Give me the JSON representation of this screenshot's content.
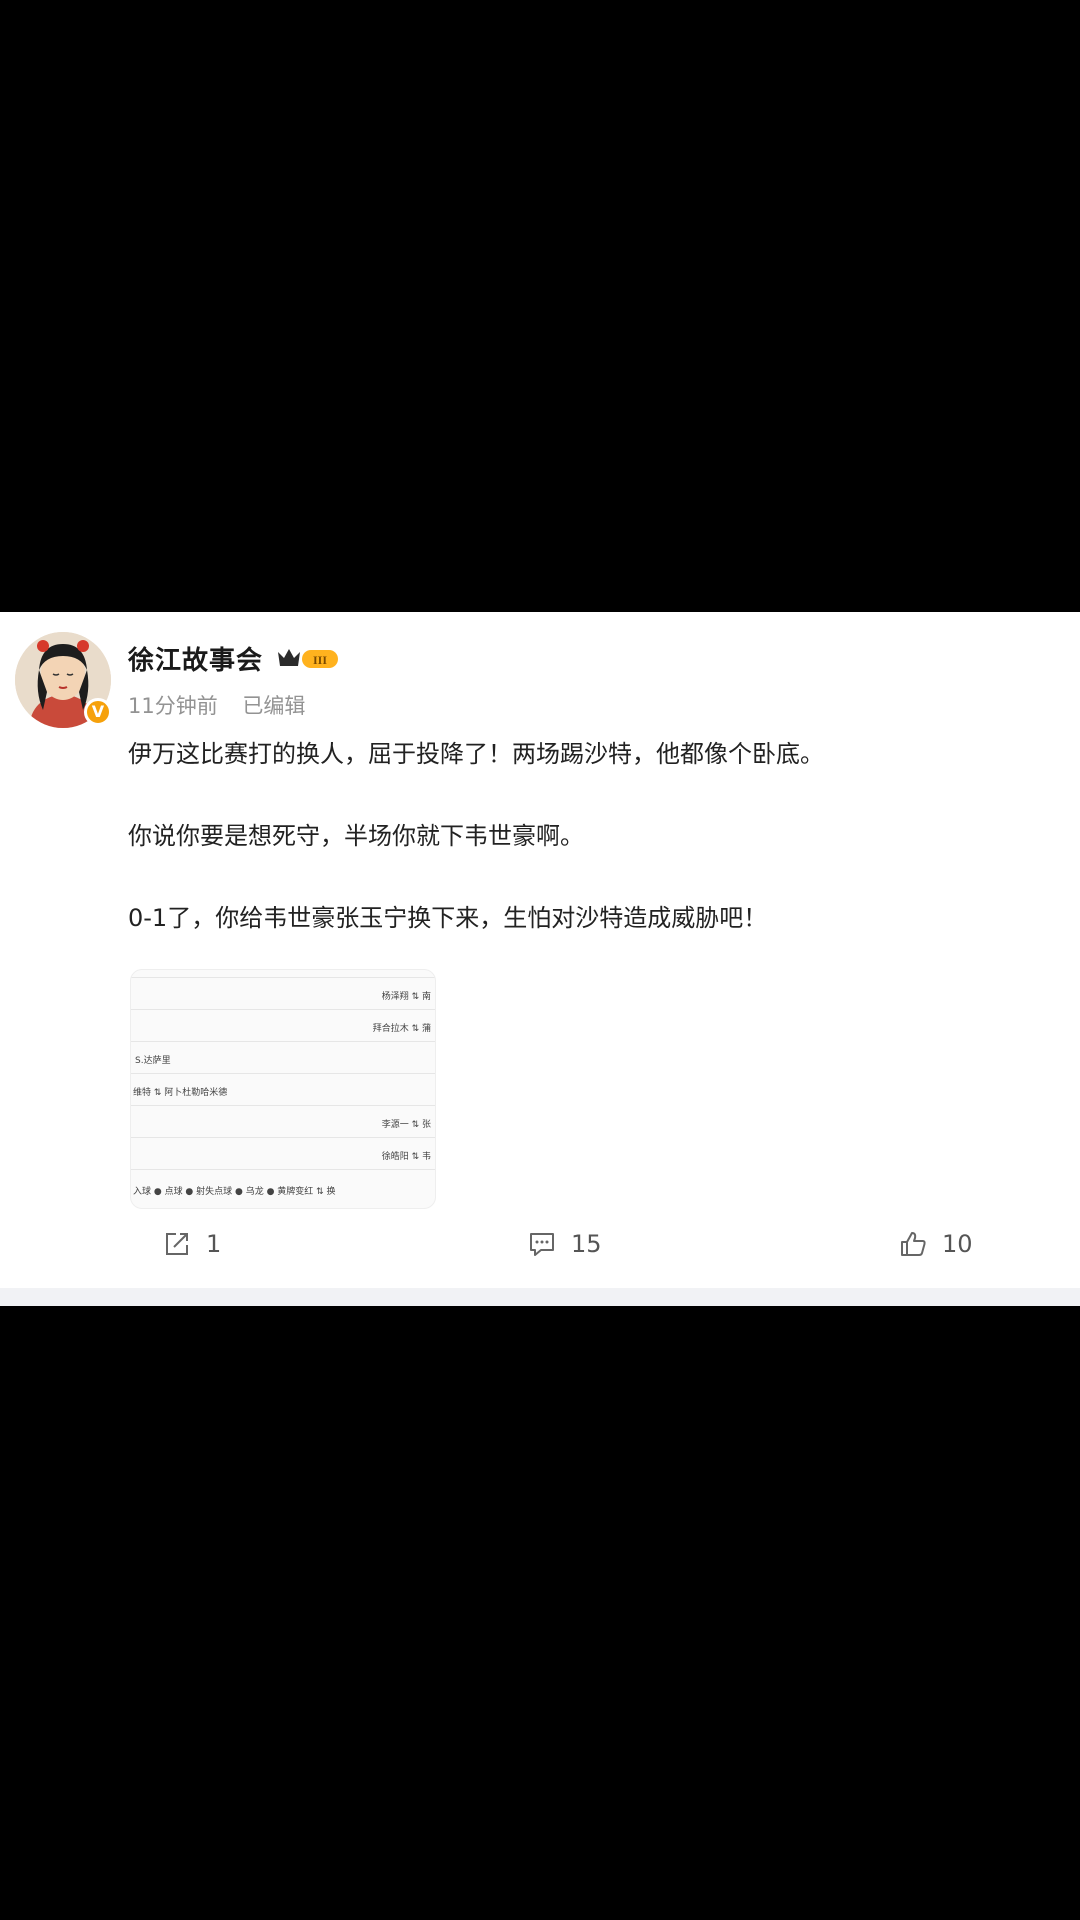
{
  "post": {
    "username": "徐江故事会",
    "member_level": "III",
    "verified_mark": "V",
    "time": "11分钟前",
    "edited": "已编辑",
    "paragraphs": [
      "伊万这比赛打的换人，屈于投降了！两场踢沙特，他都像个卧底。",
      "你说你要是想死守，半场你就下韦世豪啊。",
      "0-1了，你给韦世豪张玉宁换下来，生怕对沙特造成威胁吧！"
    ]
  },
  "thumbnail": {
    "rows": [
      {
        "left": "",
        "right": "杨泽翔 ⇅ 南"
      },
      {
        "left": "",
        "right": "拜合拉木 ⇅ 蒲"
      },
      {
        "left": "S.达萨里",
        "right": ""
      },
      {
        "left": "维特 ⇅ 阿卜杜勒哈米德",
        "right": ""
      },
      {
        "left": "",
        "right": "李源一 ⇅ 张"
      },
      {
        "left": "",
        "right": "徐皓阳 ⇅ 韦"
      }
    ],
    "legend": "入球 ● 点球 ● 射失点球 ● 乌龙 ● 黄牌变红 ⇅ 换"
  },
  "actions": {
    "repost_count": "1",
    "comment_count": "15",
    "like_count": "10",
    "icons": [
      "share-icon",
      "comment-icon",
      "like-icon"
    ]
  },
  "colors": {
    "badge": "#f6a10b",
    "text": "#222222",
    "meta": "#939393",
    "sub_in": "#2e9a47",
    "sub_out": "#d93a2b"
  }
}
